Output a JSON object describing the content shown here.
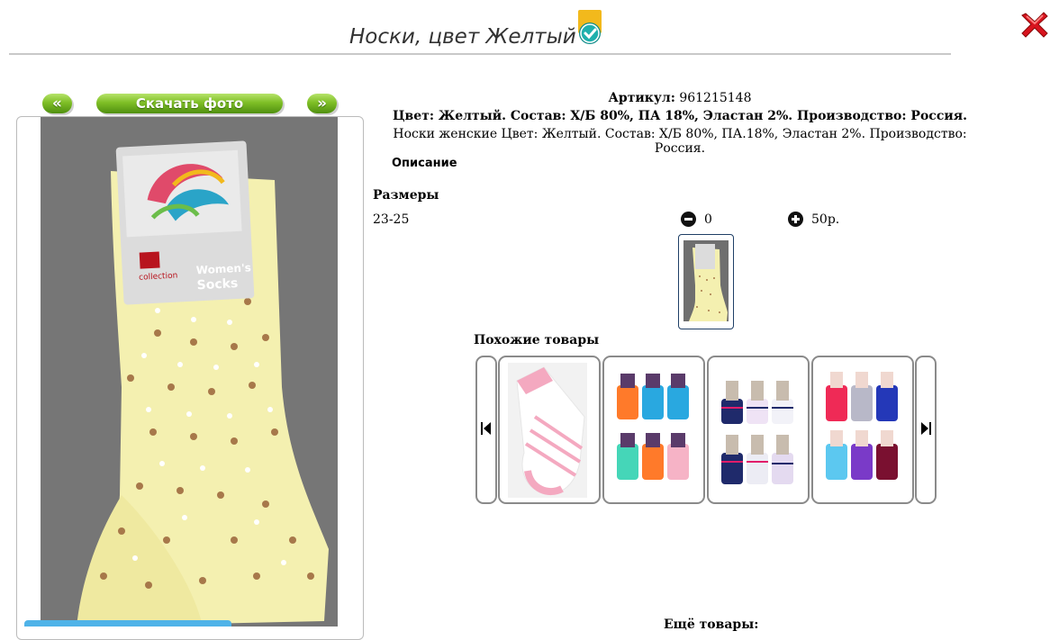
{
  "product": {
    "title": "Носки, цвет Желтый",
    "article_label": "Артикул:",
    "article_value": "961215148",
    "composition": "Цвет: Желтый. Состав: Х/Б 80%, ПА 18%, Эластан 2%. Производство: Россия.",
    "full_text": "Носки женские Цвет: Желтый. Состав: Х/Б 80%, ПА.18%, Эластан 2%. Производство: Россия."
  },
  "photo_nav": {
    "prev_label": "«",
    "download_label": "Скачать фото",
    "next_label": "»"
  },
  "photo_card_text": {
    "brand": "collection",
    "line1": "Women's",
    "line2": "Socks"
  },
  "description_link": "Описание",
  "sizes": {
    "heading": "Размеры",
    "rows": [
      {
        "name": "23-25",
        "quantity": "0",
        "price": "50р."
      }
    ]
  },
  "similar": {
    "heading": "Похожие товары"
  },
  "more_heading": "Ещё товары:",
  "icons": {
    "close": "close-x-icon",
    "verified": "verified-badge-icon",
    "minus": "minus-circle-icon",
    "plus": "plus-circle-icon",
    "prev": "skip-back-icon",
    "next": "skip-forward-icon"
  },
  "colors": {
    "button_green": "#7fbf26",
    "close_red": "#d8141e",
    "thumb_border": "#1f3f66",
    "photo_bg": "#767676",
    "sock_yellow": "#f4f0b0"
  }
}
